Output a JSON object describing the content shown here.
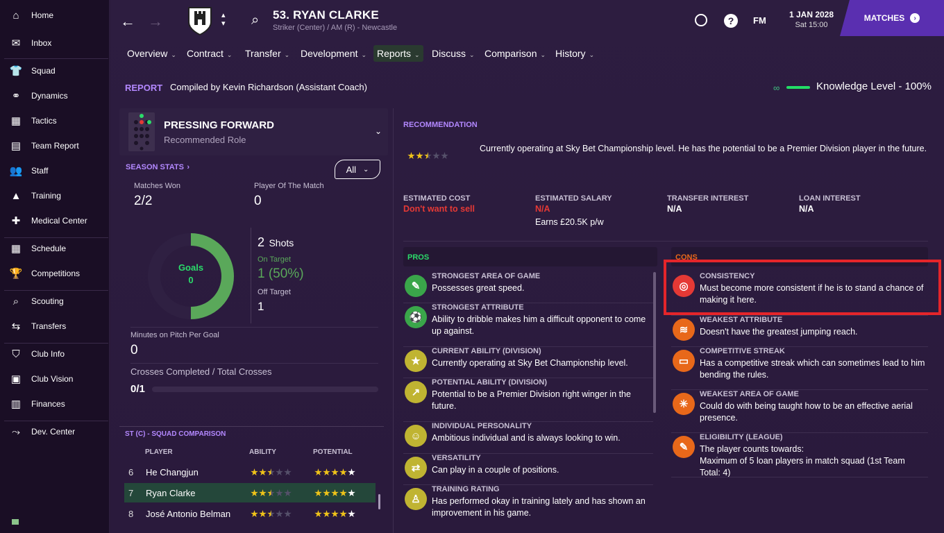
{
  "sidebar": {
    "items": [
      {
        "label": "Home",
        "icon": "home-icon",
        "glyph": "⌂"
      },
      {
        "label": "Inbox",
        "icon": "inbox-icon",
        "glyph": "✉"
      },
      {
        "label": "Squad",
        "icon": "shirt-icon",
        "glyph": "👕"
      },
      {
        "label": "Dynamics",
        "icon": "dynamics-icon",
        "glyph": "⚭"
      },
      {
        "label": "Tactics",
        "icon": "tactics-icon",
        "glyph": "▦"
      },
      {
        "label": "Team Report",
        "icon": "clipboard-icon",
        "glyph": "▤"
      },
      {
        "label": "Staff",
        "icon": "staff-icon",
        "glyph": "👥"
      },
      {
        "label": "Training",
        "icon": "training-icon",
        "glyph": "▲"
      },
      {
        "label": "Medical Center",
        "icon": "medical-icon",
        "glyph": "✚"
      },
      {
        "label": "Schedule",
        "icon": "calendar-icon",
        "glyph": "▦"
      },
      {
        "label": "Competitions",
        "icon": "trophy-icon",
        "glyph": "🏆"
      },
      {
        "label": "Scouting",
        "icon": "search-icon",
        "glyph": "⌕"
      },
      {
        "label": "Transfers",
        "icon": "transfer-icon",
        "glyph": "⇆"
      },
      {
        "label": "Club Info",
        "icon": "shield-icon",
        "glyph": "⛉"
      },
      {
        "label": "Club Vision",
        "icon": "briefcase-icon",
        "glyph": "▣"
      },
      {
        "label": "Finances",
        "icon": "money-icon",
        "glyph": "▥"
      },
      {
        "label": "Dev. Center",
        "icon": "dev-icon",
        "glyph": "⤳"
      }
    ]
  },
  "header": {
    "player_name": "53. RYAN CLARKE",
    "player_sub": "Striker (Center) / AM (R) - Newcastle",
    "fm_label": "FM",
    "date": "1 JAN 2028",
    "time": "Sat 15:00",
    "matches_label": "MATCHES"
  },
  "tabs": [
    {
      "label": "Overview"
    },
    {
      "label": "Contract"
    },
    {
      "label": "Transfer"
    },
    {
      "label": "Development"
    },
    {
      "label": "Reports"
    },
    {
      "label": "Discuss"
    },
    {
      "label": "Comparison"
    },
    {
      "label": "History"
    }
  ],
  "report": {
    "label": "REPORT",
    "compiled_by": "Compiled by Kevin Richardson (Assistant Coach)",
    "knowledge": "Knowledge Level - 100%",
    "knowledge_value": 1.0
  },
  "role": {
    "title": "PRESSING FORWARD",
    "sub": "Recommended Role"
  },
  "season_stats": {
    "title": "SEASON STATS",
    "competition": "All",
    "matches_won_label": "Matches Won",
    "matches_won": "2/2",
    "potm_label": "Player Of The Match",
    "potm": "0",
    "goals_label": "Goals",
    "goals": "0",
    "shots_value": "2",
    "shots_label": "Shots",
    "on_target_label": "On Target",
    "on_target": "1 (50%)",
    "off_target_label": "Off Target",
    "off_target": "1",
    "minutes_label": "Minutes on Pitch Per Goal",
    "minutes": "0",
    "crosses_label": "Crosses Completed / Total Crosses",
    "crosses": "0/1",
    "crosses_fraction": 0
  },
  "comparison": {
    "title": "ST (C) - SQUAD COMPARISON",
    "col_player": "PLAYER",
    "col_ability": "ABILITY",
    "col_potential": "POTENTIAL",
    "rows": [
      {
        "num": "6",
        "name": "He Changjun",
        "ability": 2.5,
        "potential": 5
      },
      {
        "num": "7",
        "name": "Ryan Clarke",
        "ability": 2.5,
        "potential": 5
      },
      {
        "num": "8",
        "name": "José Antonio Belman",
        "ability": 2.5,
        "potential": 5
      }
    ]
  },
  "recommendation": {
    "title": "RECOMMENDATION",
    "stars": 2.5,
    "text": "Currently operating at Sky Bet Championship level. He has the potential to be a Premier Division player in the future.",
    "est_cost_label": "ESTIMATED COST",
    "est_cost": "Don't want to sell",
    "est_salary_label": "ESTIMATED SALARY",
    "est_salary": "N/A",
    "earns": "Earns £20.5K p/w",
    "transfer_interest_label": "TRANSFER INTEREST",
    "transfer_interest": "N/A",
    "loan_interest_label": "LOAN INTEREST",
    "loan_interest": "N/A"
  },
  "pros": {
    "title": "PROS",
    "items": [
      {
        "title": "STRONGEST AREA OF GAME",
        "desc": "Possesses great speed.",
        "icon": "speed-icon",
        "glyph": "✎"
      },
      {
        "title": "STRONGEST ATTRIBUTE",
        "desc": "Ability to dribble makes him a difficult opponent to come up against.",
        "icon": "dribble-icon",
        "glyph": "⚽"
      },
      {
        "title": "CURRENT ABILITY (DIVISION)",
        "desc": "Currently operating at Sky Bet Championship level.",
        "icon": "star-icon",
        "glyph": "★"
      },
      {
        "title": "POTENTIAL ABILITY (DIVISION)",
        "desc": "Potential to be a Premier Division right winger in the future.",
        "icon": "trend-up-icon",
        "glyph": "↗"
      },
      {
        "title": "INDIVIDUAL PERSONALITY",
        "desc": "Ambitious individual and is always looking to win.",
        "icon": "head-icon",
        "glyph": "☺"
      },
      {
        "title": "VERSATILITY",
        "desc": "Can play in a couple of positions.",
        "icon": "arrows-icon",
        "glyph": "⇄"
      },
      {
        "title": "TRAINING RATING",
        "desc": "Has performed okay in training lately and has shown an improvement in his game.",
        "icon": "training-rating-icon",
        "glyph": "♙"
      }
    ]
  },
  "cons": {
    "title": "CONS",
    "items": [
      {
        "title": "CONSISTENCY",
        "desc": "Must become more consistent if he is to stand a chance of making it here.",
        "icon": "target-icon",
        "glyph": "◎"
      },
      {
        "title": "WEAKEST ATTRIBUTE",
        "desc": "Doesn't have the greatest jumping reach.",
        "icon": "jump-icon",
        "glyph": "≋"
      },
      {
        "title": "COMPETITIVE STREAK",
        "desc": "Has a competitive streak which can sometimes lead to him bending the rules.",
        "icon": "card-icon",
        "glyph": "▭"
      },
      {
        "title": "WEAKEST AREA OF GAME",
        "desc": "Could do with being taught how to be an effective aerial presence.",
        "icon": "aerial-icon",
        "glyph": "✳"
      },
      {
        "title": "ELIGIBILITY (LEAGUE)",
        "desc": "The player counts towards:\nMaximum of 5 loan players in match squad (1st Team Total: 4)",
        "icon": "document-icon",
        "glyph": "✎"
      }
    ]
  },
  "colors": {
    "accent": "#b388ff",
    "green": "#5aa85a",
    "red": "#e53935",
    "orange": "#e8681a",
    "brand": "#5a2fb0"
  }
}
